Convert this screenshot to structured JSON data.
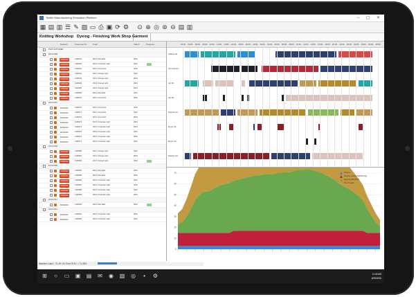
{
  "window": {
    "title": "Textile Manufacturing Simulation Platform"
  },
  "toolbar": {
    "icons": [
      "grid-icon",
      "layers-icon",
      "layout-icon",
      "list-icon",
      "edit-icon",
      "chart-icon",
      "document-icon",
      "print-icon",
      "image-icon",
      "refresh-icon",
      "settings-icon",
      "zoom-icon",
      "zoom-in-icon",
      "zoom-fit-icon",
      "zoom-reset-icon",
      "zoom-out-icon",
      "report-icon",
      "export-icon"
    ]
  },
  "tabs": [
    {
      "label": "Knitting Workshop",
      "active": false
    },
    {
      "label": "Dyeing - Finishing Work Shop",
      "active": true
    },
    {
      "label": "Garment",
      "active": false
    }
  ],
  "order_table": {
    "headers": [
      "",
      "Delivery",
      "Customer ID",
      "Color",
      "Fabric",
      "Progress"
    ],
    "rows": [
      {
        "type": "group",
        "label": "TEXTCUSTOMER"
      },
      {
        "type": "group",
        "label": "DOC17458"
      },
      {
        "type": "item",
        "delivery": "7/25/2020",
        "red": true,
        "cust": "1400016",
        "color": "800 1 Red Dark",
        "fabric": "0001",
        "progress": false
      },
      {
        "type": "item",
        "delivery": "7/25/2020",
        "red": true,
        "cust": "1400032",
        "color": "500 1 Turquoise Light",
        "fabric": "0001",
        "progress": true
      },
      {
        "type": "item",
        "delivery": "7/25/2020",
        "red": true,
        "cust": "1400024",
        "color": "600 1 Grey Dark",
        "fabric": "0001",
        "progress": false
      },
      {
        "type": "item",
        "delivery": "7/25/2020",
        "red": true,
        "cust": "1400031",
        "color": "200 1 Orange Light",
        "fabric": "0001",
        "progress": false
      },
      {
        "type": "item",
        "delivery": "7/25/2020",
        "red": true,
        "cust": "1400042",
        "color": "200 1 Orange Light",
        "fabric": "0001",
        "progress": false
      },
      {
        "type": "item",
        "delivery": "7/25/2020",
        "red": true,
        "cust": "1400049",
        "color": "200 1 Orange Light",
        "fabric": "0001",
        "progress": false
      },
      {
        "type": "item",
        "delivery": "7/25/2020",
        "red": true,
        "cust": "1400056",
        "color": "200 1 Orange Light",
        "fabric": "0001",
        "progress": false
      },
      {
        "type": "item",
        "delivery": "7/25/2020",
        "red": true,
        "cust": "1400063",
        "color": "800 1 Red Dark",
        "fabric": "0001",
        "progress": false
      },
      {
        "type": "item",
        "delivery": "7/25/2020",
        "red": true,
        "cust": "1400070",
        "color": "600 1 Grey Dark",
        "fabric": "0001",
        "progress": false
      },
      {
        "type": "group",
        "label": "DOC17457"
      },
      {
        "type": "item",
        "delivery": "8/25/2020",
        "red": false,
        "cust": "1400270",
        "color": "600 1 Grey Dark",
        "fabric": "0001",
        "progress": false
      },
      {
        "type": "item",
        "delivery": "8/25/2020",
        "red": false,
        "cust": "1400271",
        "color": "600 1 Grey Dark",
        "fabric": "0001",
        "progress": false
      },
      {
        "type": "item",
        "delivery": "8/25/2020",
        "red": false,
        "cust": "1400272",
        "color": "600 1 Grey Dark",
        "fabric": "0001",
        "progress": false
      },
      {
        "type": "item",
        "delivery": "8/25/2020",
        "red": false,
        "cust": "1400273",
        "color": "500 1 Turquoise Light",
        "fabric": "0001",
        "progress": false
      },
      {
        "type": "item",
        "delivery": "8/25/2020",
        "red": false,
        "cust": "1400274",
        "color": "500 1 Turquoise Light",
        "fabric": "0001",
        "progress": false
      },
      {
        "type": "item",
        "delivery": "8/25/2020",
        "red": false,
        "cust": "1400275",
        "color": "500 1 Turquoise Light",
        "fabric": "0001",
        "progress": false
      },
      {
        "type": "item",
        "delivery": "8/25/2020",
        "red": false,
        "cust": "1400276",
        "color": "500 1 Turquoise Light",
        "fabric": "0001",
        "progress": false
      },
      {
        "type": "item",
        "delivery": "8/25/2020",
        "red": false,
        "cust": "1400277",
        "color": "500 1 Turquoise Light",
        "fabric": "0001",
        "progress": false
      },
      {
        "type": "group",
        "label": "DOC17468"
      },
      {
        "type": "item",
        "delivery": "7/25/2020",
        "red": true,
        "cust": "1400280",
        "color": "200 1 Orange Light",
        "fabric": "0001",
        "progress": false
      },
      {
        "type": "item",
        "delivery": "7/25/2020",
        "red": true,
        "cust": "1400281",
        "color": "200 1 Orange Light",
        "fabric": "0001",
        "progress": false
      },
      {
        "type": "item",
        "delivery": "7/25/2020",
        "red": true,
        "cust": "1400282",
        "color": "200 1 Orange Light",
        "fabric": "0001",
        "progress": true
      },
      {
        "type": "group",
        "label": "DOC17458"
      },
      {
        "type": "item",
        "delivery": "7/25/2020",
        "red": true,
        "cust": "1400284",
        "color": "800 1 Red Dark",
        "fabric": "0001",
        "progress": false
      },
      {
        "type": "item",
        "delivery": "7/25/2020",
        "red": true,
        "cust": "1400285",
        "color": "800 1 Red Dark",
        "fabric": "0001",
        "progress": false
      },
      {
        "type": "item",
        "delivery": "7/25/2020",
        "red": true,
        "cust": "1400286",
        "color": "500 1 Turquoise Light",
        "fabric": "0001",
        "progress": false
      },
      {
        "type": "item",
        "delivery": "7/25/2020",
        "red": true,
        "cust": "1400287",
        "color": "500 1 Turquoise Light",
        "fabric": "0001",
        "progress": false
      },
      {
        "type": "item",
        "delivery": "7/25/2020",
        "red": true,
        "cust": "1400288",
        "color": "500 1 Turquoise Light",
        "fabric": "0001",
        "progress": false
      },
      {
        "type": "item",
        "delivery": "7/25/2020",
        "red": true,
        "cust": "1400289",
        "color": "500 1 Turquoise Light",
        "fabric": "0001",
        "progress": false
      },
      {
        "type": "group",
        "label": "DOC17411"
      },
      {
        "type": "item",
        "delivery": "8/25/2020",
        "red": false,
        "cust": "1400290",
        "color": "800 1 Red Dark",
        "fabric": "0001",
        "progress": true
      },
      {
        "type": "group",
        "label": "DOC17412"
      },
      {
        "type": "item",
        "delivery": "8/25/2020",
        "red": false,
        "cust": "1400291",
        "color": "500 1 Turquoise Light",
        "fabric": "0001",
        "progress": false
      },
      {
        "type": "item",
        "delivery": "8/25/2020",
        "red": false,
        "cust": "1400292",
        "color": "500 1 Turquoise Light",
        "fabric": "0001",
        "progress": false
      }
    ]
  },
  "status": {
    "text": "Machine Load = 72,4%  On Time Of D= = 71,45%"
  },
  "gantt": {
    "times": [
      "02:00",
      "04:00",
      "06:00",
      "08:00",
      "10:00",
      "12:00",
      "14:00",
      "16:00",
      "18:00",
      "20:00",
      "22:00",
      "00:00",
      "02:00",
      "04:00",
      "06:00",
      "08:00",
      "10:00",
      "12:00",
      "14:00",
      "16:00",
      "18:00",
      "20:00",
      "22:00",
      "00:00",
      "02:00",
      "04:00",
      "06:00",
      "08:00"
    ],
    "lanes": [
      {
        "label": "Airflow 01",
        "bars": [
          [
            0.02,
            0.09,
            "#2a8fd6"
          ],
          [
            0.1,
            0.27,
            "#22a8a0"
          ],
          [
            0.28,
            0.37,
            "#2a8fd6"
          ],
          [
            0.47,
            0.77,
            "#2f3f6f"
          ],
          [
            0.78,
            0.95,
            "#d84a4a"
          ]
        ]
      },
      {
        "label": "Air Flow 01",
        "bars": [
          [
            0.15,
            0.29,
            "#1f1f2a"
          ],
          [
            0.3,
            0.38,
            "#1f1f2a"
          ],
          [
            0.4,
            0.68,
            "#b02a3a"
          ],
          [
            0.69,
            0.95,
            "#2f3f6f"
          ]
        ]
      },
      {
        "label": "Jet 01",
        "bars": [
          [
            0.02,
            0.09,
            "#22a8a0"
          ],
          [
            0.11,
            0.16,
            "#ddc3bd"
          ],
          [
            0.17,
            0.26,
            "#ddc3bd"
          ],
          [
            0.3,
            0.32,
            "#ddc3bd"
          ],
          [
            0.34,
            0.58,
            "#2f3f6f"
          ],
          [
            0.59,
            0.67,
            "#c19a56"
          ],
          [
            0.68,
            0.87,
            "#b58a2a"
          ],
          [
            0.88,
            0.95,
            "#22a8a0"
          ]
        ]
      },
      {
        "label": "Jet 02",
        "bars": [
          [
            0.11,
            0.13,
            "#1f1f2a"
          ],
          [
            0.21,
            0.22,
            "#1f1f2a"
          ],
          [
            0.3,
            0.31,
            "#1f1f2a"
          ],
          [
            0.33,
            0.34,
            "#1f1f2a"
          ],
          [
            0.5,
            0.51,
            "#1f1f2a"
          ],
          [
            0.52,
            0.95,
            "#ddc3bd"
          ]
        ]
      },
      {
        "label": "Stenter 01",
        "bars": [
          [
            0.02,
            0.19,
            "#c19a56"
          ],
          [
            0.2,
            0.27,
            "#2f3f6f"
          ],
          [
            0.28,
            0.38,
            "#c19a56"
          ],
          [
            0.39,
            0.62,
            "#b58a2a"
          ],
          [
            0.63,
            0.78,
            "#8ab85a"
          ],
          [
            0.79,
            0.86,
            "#b58a2a"
          ],
          [
            0.87,
            0.95,
            "#c19a56"
          ]
        ]
      },
      {
        "label": "Dryer 01",
        "bars": [
          [
            0.18,
            0.2,
            "#8a1f2a"
          ],
          [
            0.24,
            0.26,
            "#8a1f2a"
          ],
          [
            0.36,
            0.37,
            "#2f3f6f"
          ],
          [
            0.38,
            0.4,
            "#8a1f2a"
          ],
          [
            0.48,
            0.51,
            "#8a1f2a"
          ],
          [
            0.68,
            0.69,
            "#8a1f2a"
          ],
          [
            0.88,
            0.9,
            "#8a1f2a"
          ]
        ]
      },
      {
        "label": "Dryer 02",
        "bars": [
          [
            0.62,
            0.63,
            "#1f1f2a"
          ],
          [
            0.66,
            0.67,
            "#1f1f2a"
          ]
        ]
      },
      {
        "label": "Stenter 02",
        "bars": [
          [
            0.02,
            0.05,
            "#2f3f6f"
          ],
          [
            0.06,
            0.44,
            "#8a1f2a"
          ],
          [
            0.45,
            0.64,
            "#2f3f6f"
          ],
          [
            0.65,
            0.9,
            "#ddc3bd"
          ]
        ]
      }
    ]
  },
  "chart_data": {
    "type": "area",
    "title": "",
    "xlabel": "",
    "ylabel": "",
    "ylim": [
      0,
      70
    ],
    "yticks": [
      0,
      10,
      20,
      30,
      40,
      50,
      60,
      70
    ],
    "x": [
      0,
      1,
      2,
      3,
      4,
      5,
      6,
      7,
      8,
      9,
      10,
      11,
      12,
      13,
      14,
      15,
      16,
      17,
      18,
      19,
      20,
      21,
      22,
      23,
      24,
      25,
      26,
      27,
      28,
      29,
      30,
      31,
      32,
      33,
      34,
      35,
      36,
      37,
      38,
      39,
      40,
      41,
      42,
      43,
      44,
      45,
      46,
      47
    ],
    "series": [
      {
        "name": "Dryers",
        "color": "#3b86d8",
        "values": [
          3,
          3,
          3,
          3,
          3,
          3,
          3,
          3,
          3,
          3,
          3,
          3,
          3,
          3,
          3,
          3,
          3,
          3,
          3,
          3,
          3,
          3,
          3,
          3,
          3,
          3,
          3,
          3,
          3,
          3,
          3,
          3,
          3,
          3,
          3,
          3,
          3,
          3,
          3,
          3,
          3,
          3,
          3,
          3,
          3,
          3,
          3,
          3
        ]
      },
      {
        "name": "Stenter (Heat Stabilizing)",
        "color": "#c0203a",
        "values": [
          12,
          12,
          12,
          12,
          12,
          12,
          12,
          12,
          12,
          12,
          12,
          12,
          12,
          14,
          14,
          14,
          14,
          14,
          14,
          14,
          14,
          14,
          14,
          14,
          14,
          14,
          14,
          14,
          14,
          14,
          14,
          14,
          14,
          14,
          14,
          14,
          14,
          14,
          14,
          14,
          14,
          14,
          14,
          14,
          12,
          12,
          12,
          12
        ]
      },
      {
        "name": "Dyeing Machine",
        "color": "#6aa84f",
        "values": [
          8,
          10,
          15,
          22,
          30,
          35,
          38,
          38,
          40,
          42,
          44,
          45,
          46,
          46,
          47,
          48,
          49,
          50,
          51,
          51,
          52,
          52,
          52,
          53,
          53,
          54,
          54,
          55,
          56,
          56,
          57,
          56,
          55,
          54,
          52,
          50,
          48,
          45,
          42,
          40,
          38,
          35,
          32,
          28,
          22,
          16,
          10,
          6
        ]
      },
      {
        "name": "Pre-Treatm",
        "color": "#c39a42",
        "values": [
          10,
          12,
          16,
          20,
          24,
          26,
          28,
          30,
          32,
          30,
          28,
          26,
          24,
          22,
          22,
          20,
          20,
          18,
          18,
          16,
          16,
          16,
          18,
          20,
          22,
          24,
          26,
          26,
          24,
          22,
          20,
          18,
          16,
          16,
          14,
          14,
          16,
          18,
          20,
          22,
          20,
          18,
          16,
          14,
          12,
          10,
          8,
          6
        ]
      }
    ]
  },
  "taskbar": {
    "icons": [
      "windows-icon",
      "search-icon",
      "task-view-icon",
      "file-explorer-icon",
      "store-icon",
      "mail-icon",
      "edge-icon",
      "photos-icon",
      "browser-icon",
      "app-icon",
      "settings-icon"
    ],
    "time": "11:45 AM",
    "date": "8/25/2020"
  }
}
